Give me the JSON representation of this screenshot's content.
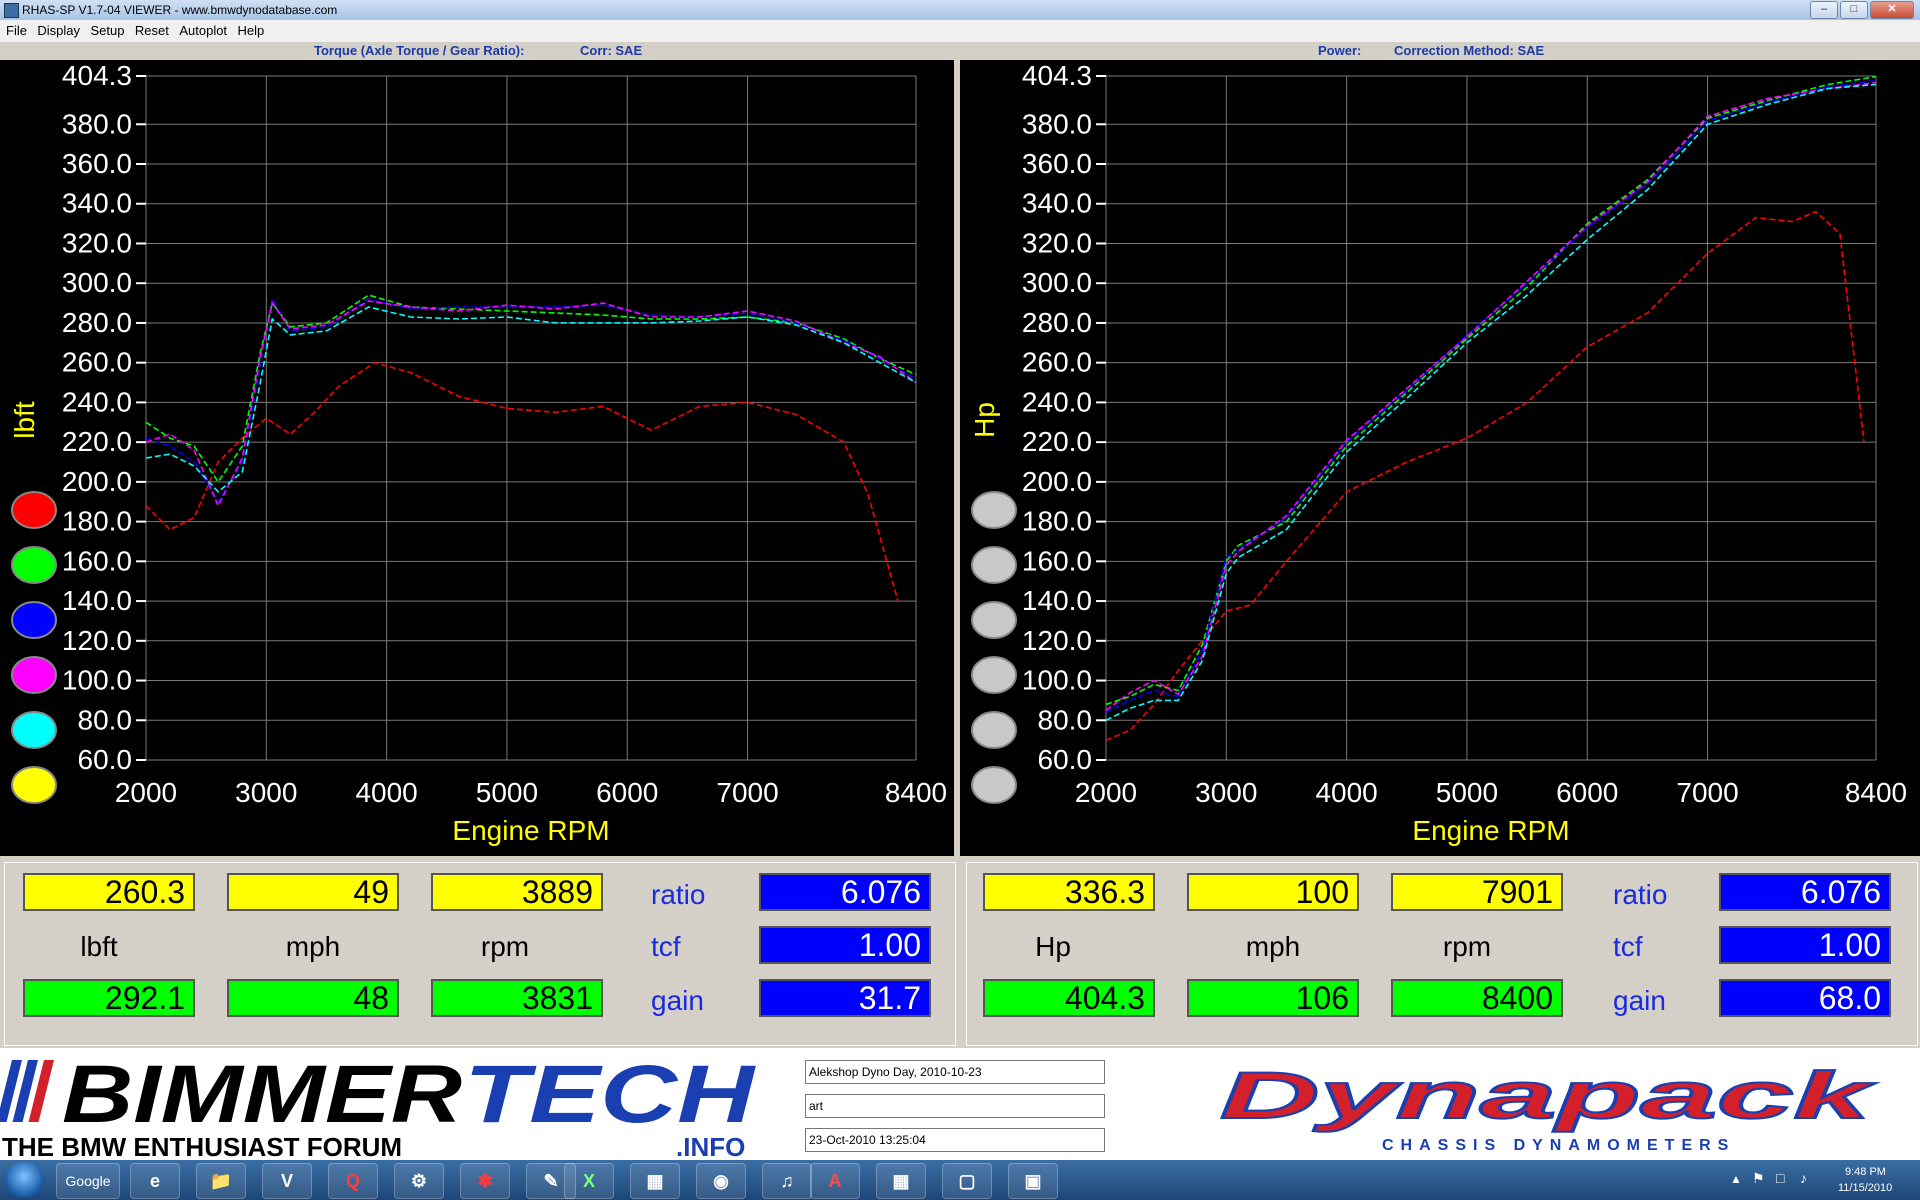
{
  "window": {
    "title": "RHAS-SP V1.7-04  VIEWER - www.bmwdynodatabase.com"
  },
  "menu": [
    "File",
    "Display",
    "Setup",
    "Reset",
    "Autoplot",
    "Help"
  ],
  "left_header": {
    "main": "Torque (Axle Torque / Gear Ratio):",
    "corr": "Corr: SAE"
  },
  "right_header": {
    "main": "Power:",
    "corr": "Correction Method: SAE"
  },
  "colors": {
    "red": "#ff0000",
    "green": "#00ff00",
    "blue": "#0000ff",
    "magenta": "#ff00ff",
    "cyan": "#00ffff",
    "yellow": "#ffff00",
    "grid": "#7a7a7a",
    "axis_text": "#ffffff",
    "label_text": "#ffff00"
  },
  "chart_data": [
    {
      "type": "line",
      "ylabel": "lbft",
      "xlabel": "Engine RPM",
      "xlim": [
        2000,
        8400
      ],
      "ylim": [
        60,
        404.3
      ],
      "x_ticks": [
        "2000",
        "3000",
        "4000",
        "5000",
        "6000",
        "7000",
        "8400"
      ],
      "y_ticks": [
        "404.3",
        "380.0",
        "360.0",
        "340.0",
        "320.0",
        "300.0",
        "280.0",
        "260.0",
        "240.0",
        "220.0",
        "200.0",
        "180.0",
        "160.0",
        "140.0",
        "120.0",
        "100.0",
        "80.0",
        "60.0"
      ],
      "series": [
        {
          "color": "red",
          "x": [
            2000,
            2200,
            2400,
            2600,
            2800,
            3000,
            3200,
            3400,
            3600,
            3900,
            4200,
            4600,
            5000,
            5400,
            5800,
            6200,
            6600,
            7000,
            7400,
            7800,
            8000,
            8250
          ],
          "values": [
            188,
            176,
            182,
            210,
            222,
            232,
            224,
            235,
            248,
            260,
            255,
            243,
            237,
            235,
            238,
            226,
            238,
            240,
            234,
            220,
            194,
            140
          ]
        },
        {
          "color": "green",
          "x": [
            2000,
            2200,
            2400,
            2600,
            2800,
            2950,
            3050,
            3200,
            3500,
            3850,
            4200,
            4600,
            5000,
            5400,
            5800,
            6200,
            6600,
            7000,
            7400,
            7800,
            8100,
            8400
          ],
          "values": [
            230,
            222,
            218,
            200,
            218,
            265,
            290,
            278,
            280,
            294,
            288,
            287,
            286,
            285,
            284,
            282,
            282,
            283,
            280,
            272,
            262,
            254
          ]
        },
        {
          "color": "blue",
          "x": [
            2000,
            2200,
            2400,
            2600,
            2800,
            2950,
            3050,
            3200,
            3500,
            3850,
            4200,
            4600,
            5000,
            5400,
            5800,
            6200,
            6600,
            7000,
            7400,
            7800,
            8100,
            8400
          ],
          "values": [
            222,
            218,
            210,
            190,
            210,
            260,
            292,
            276,
            278,
            292,
            287,
            288,
            288,
            288,
            289,
            284,
            283,
            285,
            280,
            271,
            262,
            252
          ]
        },
        {
          "color": "magenta",
          "x": [
            2000,
            2200,
            2400,
            2600,
            2800,
            2950,
            3050,
            3200,
            3500,
            3850,
            4200,
            4600,
            5000,
            5400,
            5800,
            6200,
            6600,
            7000,
            7400,
            7800,
            8100,
            8400
          ],
          "values": [
            220,
            224,
            216,
            188,
            212,
            263,
            290,
            277,
            279,
            291,
            288,
            286,
            289,
            287,
            290,
            283,
            283,
            286,
            281,
            270,
            263,
            250
          ]
        },
        {
          "color": "cyan",
          "x": [
            2000,
            2200,
            2400,
            2600,
            2800,
            2950,
            3050,
            3200,
            3500,
            3850,
            4200,
            4600,
            5000,
            5400,
            5800,
            6200,
            6600,
            7000,
            7400,
            7800,
            8100,
            8400
          ],
          "values": [
            212,
            214,
            208,
            195,
            205,
            250,
            282,
            274,
            276,
            288,
            283,
            282,
            283,
            280,
            280,
            280,
            281,
            283,
            279,
            270,
            260,
            250
          ]
        }
      ]
    },
    {
      "type": "line",
      "ylabel": "Hp",
      "xlabel": "Engine RPM",
      "xlim": [
        2000,
        8400
      ],
      "ylim": [
        60,
        404.3
      ],
      "x_ticks": [
        "2000",
        "3000",
        "4000",
        "5000",
        "6000",
        "7000",
        "8400"
      ],
      "y_ticks": [
        "404.3",
        "380.0",
        "360.0",
        "340.0",
        "320.0",
        "300.0",
        "280.0",
        "260.0",
        "240.0",
        "220.0",
        "200.0",
        "180.0",
        "160.0",
        "140.0",
        "120.0",
        "100.0",
        "80.0",
        "60.0"
      ],
      "series": [
        {
          "color": "red",
          "x": [
            2000,
            2200,
            2400,
            2600,
            2800,
            3000,
            3200,
            3500,
            4000,
            4500,
            5000,
            5500,
            6000,
            6500,
            7000,
            7400,
            7700,
            7900,
            8100,
            8300
          ],
          "values": [
            70,
            75,
            88,
            105,
            120,
            135,
            138,
            160,
            195,
            210,
            222,
            240,
            268,
            285,
            315,
            333,
            331,
            336,
            325,
            220
          ]
        },
        {
          "color": "green",
          "x": [
            2000,
            2200,
            2400,
            2600,
            2800,
            3000,
            3100,
            3500,
            4000,
            4500,
            5000,
            5500,
            6000,
            6500,
            7000,
            7500,
            8000,
            8400
          ],
          "values": [
            88,
            92,
            98,
            95,
            118,
            160,
            168,
            180,
            218,
            245,
            272,
            298,
            330,
            352,
            383,
            392,
            400,
            404
          ]
        },
        {
          "color": "blue",
          "x": [
            2000,
            2200,
            2400,
            2600,
            2800,
            3000,
            3100,
            3500,
            4000,
            4500,
            5000,
            5500,
            6000,
            6500,
            7000,
            7500,
            8000,
            8400
          ],
          "values": [
            84,
            90,
            95,
            92,
            115,
            162,
            166,
            182,
            220,
            246,
            274,
            300,
            328,
            350,
            382,
            391,
            399,
            402
          ]
        },
        {
          "color": "magenta",
          "x": [
            2000,
            2200,
            2400,
            2600,
            2800,
            3000,
            3100,
            3500,
            4000,
            4500,
            5000,
            5500,
            6000,
            6500,
            7000,
            7500,
            8000,
            8400
          ],
          "values": [
            85,
            94,
            100,
            93,
            112,
            158,
            165,
            183,
            221,
            247,
            273,
            301,
            329,
            351,
            384,
            393,
            398,
            401
          ]
        },
        {
          "color": "cyan",
          "x": [
            2000,
            2200,
            2400,
            2600,
            2800,
            3000,
            3100,
            3500,
            4000,
            4500,
            5000,
            5500,
            6000,
            6500,
            7000,
            7500,
            8000,
            8400
          ],
          "values": [
            80,
            86,
            90,
            90,
            110,
            154,
            162,
            176,
            215,
            242,
            270,
            294,
            322,
            347,
            380,
            390,
            398,
            400
          ]
        }
      ]
    }
  ],
  "left_readout": {
    "top": [
      "260.3",
      "49",
      "3889"
    ],
    "units": [
      "lbft",
      "mph",
      "rpm"
    ],
    "bottom": [
      "292.1",
      "48",
      "3831"
    ],
    "labels": [
      "ratio",
      "tcf",
      "gain"
    ],
    "values": [
      "6.076",
      "1.00",
      "31.7"
    ]
  },
  "right_readout": {
    "top": [
      "336.3",
      "100",
      "7901"
    ],
    "units": [
      "Hp",
      "mph",
      "rpm"
    ],
    "bottom": [
      "404.3",
      "106",
      "8400"
    ],
    "labels": [
      "ratio",
      "tcf",
      "gain"
    ],
    "values": [
      "6.076",
      "1.00",
      "68.0"
    ]
  },
  "info": [
    "Alekshop Dyno Day, 2010-10-23",
    "art",
    "23-Oct-2010  13:25:04"
  ],
  "logos": {
    "bimmertech": {
      "part1": "BIMMER",
      "part2": "TECH",
      "tagline": "THE BMW ENTHUSIAST FORUM",
      "info": ".INFO"
    },
    "dynapack": {
      "name": "Dynapack",
      "tagline": "CHASSIS    DYNAMOMETERS"
    }
  },
  "taskbar": {
    "search": "Google",
    "time": "9:48 PM",
    "date": "11/15/2010"
  }
}
